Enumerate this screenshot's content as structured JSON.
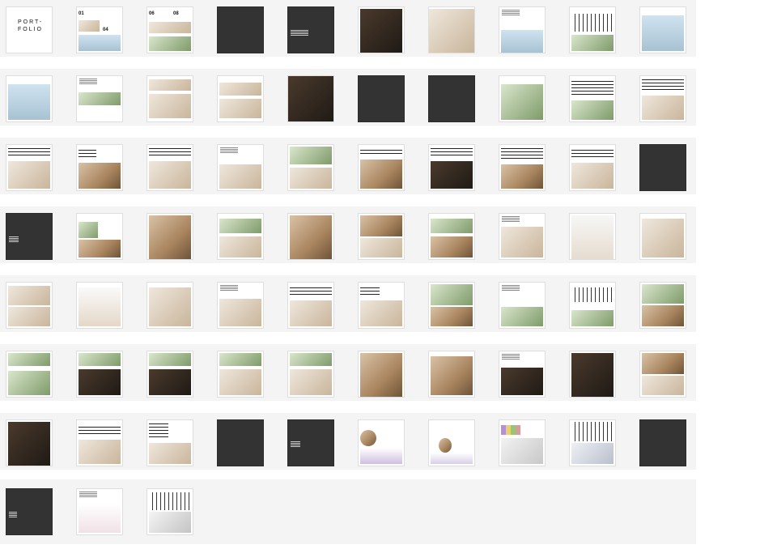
{
  "cover": {
    "title_line1": "PORT-",
    "title_line2": "FOLIO"
  },
  "page_numbers": {
    "p2_a": "01",
    "p2_b": "04",
    "p3_a": "06",
    "p3_b": "08"
  }
}
